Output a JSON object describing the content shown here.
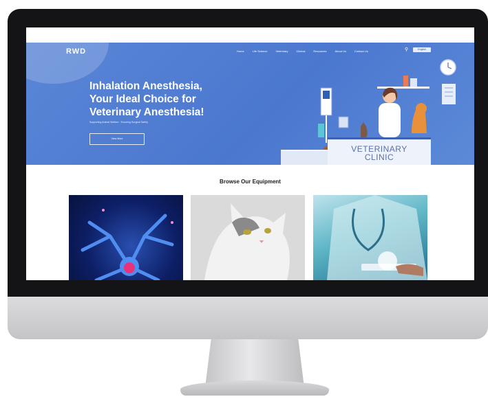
{
  "site": {
    "logo": "RWD",
    "nav": [
      "Home",
      "Life Science",
      "Veterinary",
      "Clinical",
      "Resources",
      "About Us",
      "Contact Us"
    ],
    "language": "English"
  },
  "hero": {
    "headline_line1": "Inhalation Anesthesia,",
    "headline_line2": "Your Ideal Choice for",
    "headline_line3": "Veterinary Anesthesia!",
    "subtitle": "Supporting Animal Welfare · Ensuring Surgical Safety",
    "cta_label": "View More",
    "clinic_sign_line1": "VETERINARY",
    "clinic_sign_line2": "CLINIC"
  },
  "equipment": {
    "section_title": "Browse Our Equipment",
    "tiles": [
      {
        "subject": "neuron illustration"
      },
      {
        "subject": "cat photo"
      },
      {
        "subject": "doctor with tablet"
      }
    ]
  },
  "colors": {
    "hero_blue": "#4b78cf",
    "bezel": "#141416",
    "clinic_blue": "#3d5fb4"
  }
}
